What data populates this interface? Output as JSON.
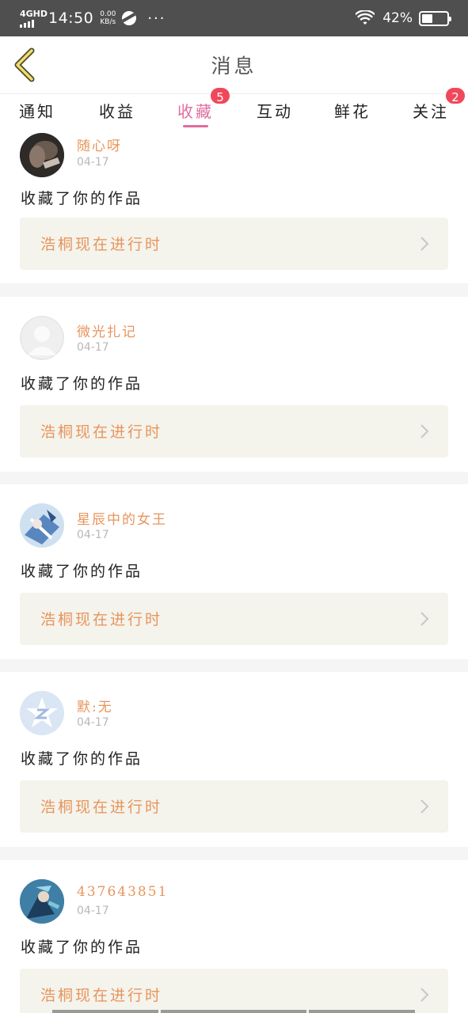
{
  "status_bar": {
    "network": "4GHD",
    "time": "14:50",
    "speed_value": "0.00",
    "speed_unit": "KB/s",
    "more": "···",
    "battery_percent": "42%",
    "battery_level": 0.42
  },
  "header": {
    "title": "消息"
  },
  "tabs": [
    {
      "label": "通知",
      "active": false,
      "badge": ""
    },
    {
      "label": "收益",
      "active": false,
      "badge": ""
    },
    {
      "label": "收藏",
      "active": true,
      "badge": "5"
    },
    {
      "label": "互动",
      "active": false,
      "badge": ""
    },
    {
      "label": "鲜花",
      "active": false,
      "badge": ""
    },
    {
      "label": "关注",
      "active": false,
      "badge": "2"
    }
  ],
  "messages": [
    {
      "username": "随心呀",
      "date": "04-17",
      "action": "收藏了你的作品",
      "work_title": "浩桐现在进行时",
      "avatar": "dark-photo"
    },
    {
      "username": "微光扎记",
      "date": "04-17",
      "action": "收藏了你的作品",
      "work_title": "浩桐现在进行时",
      "avatar": "default-gray"
    },
    {
      "username": "星辰中的女王",
      "date": "04-17",
      "action": "收藏了你的作品",
      "work_title": "浩桐现在进行时",
      "avatar": "anime-blue"
    },
    {
      "username": "默:无",
      "date": "04-17",
      "action": "收藏了你的作品",
      "work_title": "浩桐现在进行时",
      "avatar": "qzone-star"
    },
    {
      "username": "437643851",
      "date": "04-17",
      "action": "收藏了你的作品",
      "work_title": "浩桐现在进行时",
      "avatar": "anime-teal"
    }
  ],
  "colors": {
    "accent_pink": "#e06c9f",
    "username_orange": "#e8955c",
    "badge_red": "#f0485b",
    "status_bar_bg": "#4f4f4f",
    "link_bg": "#f4f3ec"
  }
}
